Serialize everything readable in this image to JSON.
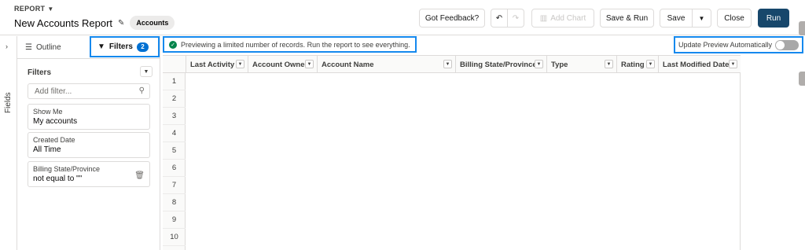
{
  "header": {
    "report_type_label": "REPORT",
    "report_title": "New Accounts Report",
    "object_badge": "Accounts",
    "toolbar": {
      "feedback": "Got Feedback?",
      "undo_icon": "undo-icon",
      "redo_icon": "redo-icon",
      "add_chart": "Add Chart",
      "save_run": "Save & Run",
      "save": "Save",
      "close": "Close",
      "run": "Run"
    }
  },
  "sidebar": {
    "fields_label": "Fields"
  },
  "left_panel": {
    "tabs": [
      {
        "label": "Outline",
        "icon": "list-icon"
      },
      {
        "label": "Filters",
        "icon": "filter-icon",
        "count": "2"
      }
    ],
    "filters_heading": "Filters",
    "add_filter_placeholder": "Add filter...",
    "filters": [
      {
        "label": "Show Me",
        "value": "My accounts"
      },
      {
        "label": "Created Date",
        "value": "All Time"
      },
      {
        "label": "Billing State/Province",
        "value": "not equal to \"\""
      }
    ]
  },
  "preview": {
    "info_message": "Previewing a limited number of records. Run the report to see everything.",
    "update_preview_label": "Update Preview Automatically",
    "update_preview_enabled": false,
    "columns": [
      "Last Activity",
      "Account Owner",
      "Account Name",
      "Billing State/Province",
      "Type",
      "Rating",
      "Last Modified Date"
    ],
    "row_numbers": [
      "1",
      "2",
      "3",
      "4",
      "5",
      "6",
      "7",
      "8",
      "9",
      "10"
    ]
  },
  "colors": {
    "primary_button": "#17476b",
    "highlight_border": "#1589ee",
    "badge_blue": "#0070d2",
    "success_green": "#04844b"
  }
}
